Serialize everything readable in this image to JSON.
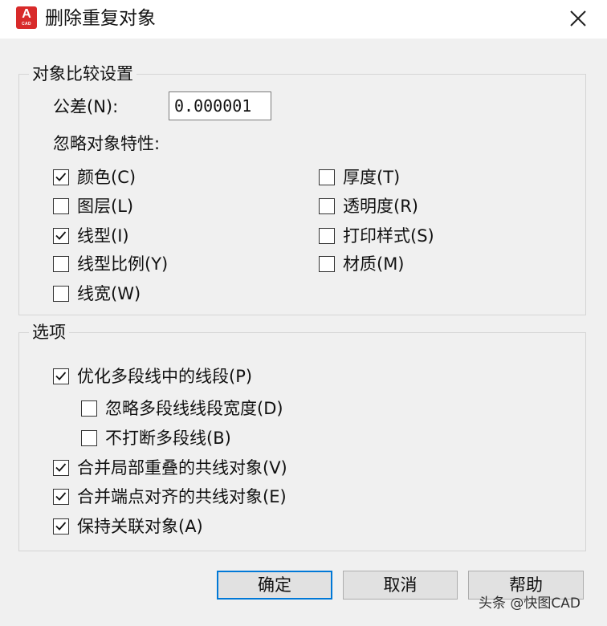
{
  "window": {
    "title": "删除重复对象",
    "icon_text": "A",
    "icon_subtext": "CAD"
  },
  "compare_group": {
    "title": "对象比较设置",
    "tolerance_label": "公差(N):",
    "tolerance_value": "0.000001",
    "ignore_label": "忽略对象特性:",
    "properties": [
      {
        "label": "颜色(C)",
        "checked": true
      },
      {
        "label": "图层(L)",
        "checked": false
      },
      {
        "label": "线型(I)",
        "checked": true
      },
      {
        "label": "线型比例(Y)",
        "checked": false
      },
      {
        "label": "线宽(W)",
        "checked": false
      },
      {
        "label": "厚度(T)",
        "checked": false
      },
      {
        "label": "透明度(R)",
        "checked": false
      },
      {
        "label": "打印样式(S)",
        "checked": false
      },
      {
        "label": "材质(M)",
        "checked": false
      }
    ]
  },
  "options_group": {
    "title": "选项",
    "options": [
      {
        "label": "优化多段线中的线段(P)",
        "checked": true
      },
      {
        "label": "忽略多段线线段宽度(D)",
        "checked": false
      },
      {
        "label": "不打断多段线(B)",
        "checked": false
      },
      {
        "label": "合并局部重叠的共线对象(V)",
        "checked": true
      },
      {
        "label": "合并端点对齐的共线对象(E)",
        "checked": true
      },
      {
        "label": "保持关联对象(A)",
        "checked": true
      }
    ]
  },
  "buttons": {
    "ok": "确定",
    "cancel": "取消",
    "help": "帮助"
  },
  "watermark": "头条 @快图CAD",
  "colors": {
    "accent": "#0078d7",
    "icon_bg": "#d82a2a",
    "dialog_bg": "#f0f0f0"
  }
}
